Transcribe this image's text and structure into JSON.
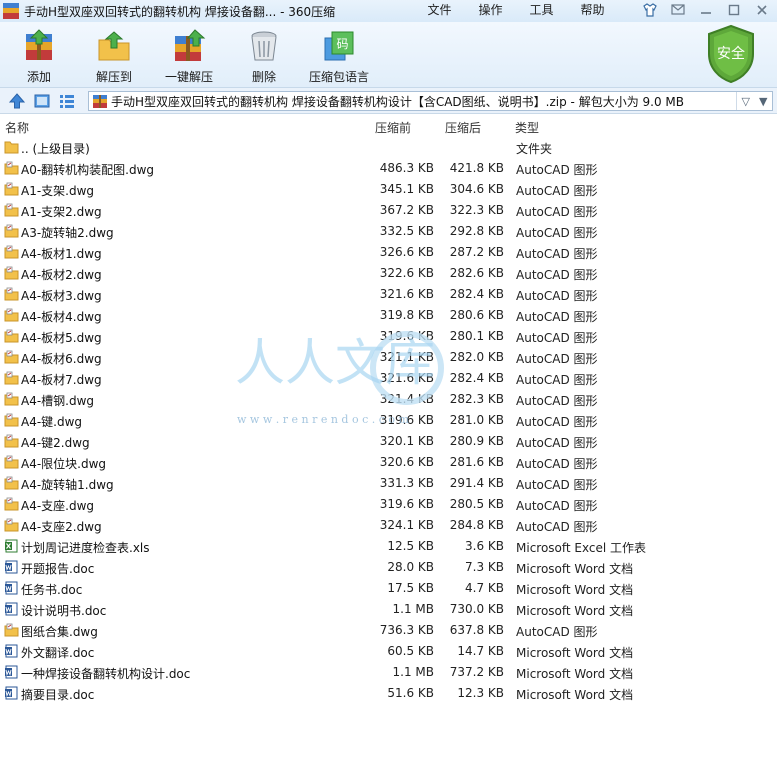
{
  "window": {
    "title": "手动H型双座双回转式的翻转机构 焊接设备翻... - 360压缩",
    "menus": [
      "文件",
      "操作",
      "工具",
      "帮助"
    ]
  },
  "toolbar": {
    "add": "添加",
    "extract_to": "解压到",
    "one_click_extract": "一键解压",
    "delete": "删除",
    "comment": "压缩包语言",
    "security": "安全"
  },
  "address": {
    "path": "手动H型双座双回转式的翻转机构 焊接设备翻转机构设计【含CAD图纸、说明书】.zip - 解包大小为 9.0 MB"
  },
  "columns": {
    "name": "名称",
    "size": "压缩前",
    "packed": "压缩后",
    "type": "类型"
  },
  "watermark": {
    "text": "人人文库",
    "url": "w w w . r e n r e n d o c . c o m"
  },
  "colors": {
    "accent": "#2f7ac7",
    "shield": "#5ea83a",
    "folder": "#f2c14a"
  },
  "files": [
    {
      "name": ".. (上级目录)",
      "size": "",
      "packed": "",
      "type": "文件夹",
      "icon": "folder-icon"
    },
    {
      "name": "A0-翻转机构装配图.dwg",
      "size": "486.3 KB",
      "packed": "421.8 KB",
      "type": "AutoCAD 图形",
      "icon": "dwg-icon"
    },
    {
      "name": "A1-支架.dwg",
      "size": "345.1 KB",
      "packed": "304.6 KB",
      "type": "AutoCAD 图形",
      "icon": "dwg-icon"
    },
    {
      "name": "A1-支架2.dwg",
      "size": "367.2 KB",
      "packed": "322.3 KB",
      "type": "AutoCAD 图形",
      "icon": "dwg-icon"
    },
    {
      "name": "A3-旋转轴2.dwg",
      "size": "332.5 KB",
      "packed": "292.8 KB",
      "type": "AutoCAD 图形",
      "icon": "dwg-icon"
    },
    {
      "name": "A4-板材1.dwg",
      "size": "326.6 KB",
      "packed": "287.2 KB",
      "type": "AutoCAD 图形",
      "icon": "dwg-icon"
    },
    {
      "name": "A4-板材2.dwg",
      "size": "322.6 KB",
      "packed": "282.6 KB",
      "type": "AutoCAD 图形",
      "icon": "dwg-icon"
    },
    {
      "name": "A4-板材3.dwg",
      "size": "321.6 KB",
      "packed": "282.4 KB",
      "type": "AutoCAD 图形",
      "icon": "dwg-icon"
    },
    {
      "name": "A4-板材4.dwg",
      "size": "319.8 KB",
      "packed": "280.6 KB",
      "type": "AutoCAD 图形",
      "icon": "dwg-icon"
    },
    {
      "name": "A4-板材5.dwg",
      "size": "319.6 KB",
      "packed": "280.1 KB",
      "type": "AutoCAD 图形",
      "icon": "dwg-icon"
    },
    {
      "name": "A4-板材6.dwg",
      "size": "321.1 KB",
      "packed": "282.0 KB",
      "type": "AutoCAD 图形",
      "icon": "dwg-icon"
    },
    {
      "name": "A4-板材7.dwg",
      "size": "321.6 KB",
      "packed": "282.4 KB",
      "type": "AutoCAD 图形",
      "icon": "dwg-icon"
    },
    {
      "name": "A4-槽钢.dwg",
      "size": "321.4 KB",
      "packed": "282.3 KB",
      "type": "AutoCAD 图形",
      "icon": "dwg-icon"
    },
    {
      "name": "A4-键.dwg",
      "size": "319.6 KB",
      "packed": "281.0 KB",
      "type": "AutoCAD 图形",
      "icon": "dwg-icon"
    },
    {
      "name": "A4-键2.dwg",
      "size": "320.1 KB",
      "packed": "280.9 KB",
      "type": "AutoCAD 图形",
      "icon": "dwg-icon"
    },
    {
      "name": "A4-限位块.dwg",
      "size": "320.6 KB",
      "packed": "281.6 KB",
      "type": "AutoCAD 图形",
      "icon": "dwg-icon"
    },
    {
      "name": "A4-旋转轴1.dwg",
      "size": "331.3 KB",
      "packed": "291.4 KB",
      "type": "AutoCAD 图形",
      "icon": "dwg-icon"
    },
    {
      "name": "A4-支座.dwg",
      "size": "319.6 KB",
      "packed": "280.5 KB",
      "type": "AutoCAD 图形",
      "icon": "dwg-icon"
    },
    {
      "name": "A4-支座2.dwg",
      "size": "324.1 KB",
      "packed": "284.8 KB",
      "type": "AutoCAD 图形",
      "icon": "dwg-icon"
    },
    {
      "name": "计划周记进度检查表.xls",
      "size": "12.5 KB",
      "packed": "3.6 KB",
      "type": "Microsoft Excel 工作表",
      "icon": "excel-icon"
    },
    {
      "name": "开题报告.doc",
      "size": "28.0 KB",
      "packed": "7.3 KB",
      "type": "Microsoft Word 文档",
      "icon": "word-icon"
    },
    {
      "name": "任务书.doc",
      "size": "17.5 KB",
      "packed": "4.7 KB",
      "type": "Microsoft Word 文档",
      "icon": "word-icon"
    },
    {
      "name": "设计说明书.doc",
      "size": "1.1 MB",
      "packed": "730.0 KB",
      "type": "Microsoft Word 文档",
      "icon": "word-icon"
    },
    {
      "name": "图纸合集.dwg",
      "size": "736.3 KB",
      "packed": "637.8 KB",
      "type": "AutoCAD 图形",
      "icon": "dwg-icon"
    },
    {
      "name": "外文翻译.doc",
      "size": "60.5 KB",
      "packed": "14.7 KB",
      "type": "Microsoft Word 文档",
      "icon": "word-icon"
    },
    {
      "name": "一种焊接设备翻转机构设计.doc",
      "size": "1.1 MB",
      "packed": "737.2 KB",
      "type": "Microsoft Word 文档",
      "icon": "word-icon"
    },
    {
      "name": "摘要目录.doc",
      "size": "51.6 KB",
      "packed": "12.3 KB",
      "type": "Microsoft Word 文档",
      "icon": "word-icon"
    }
  ]
}
